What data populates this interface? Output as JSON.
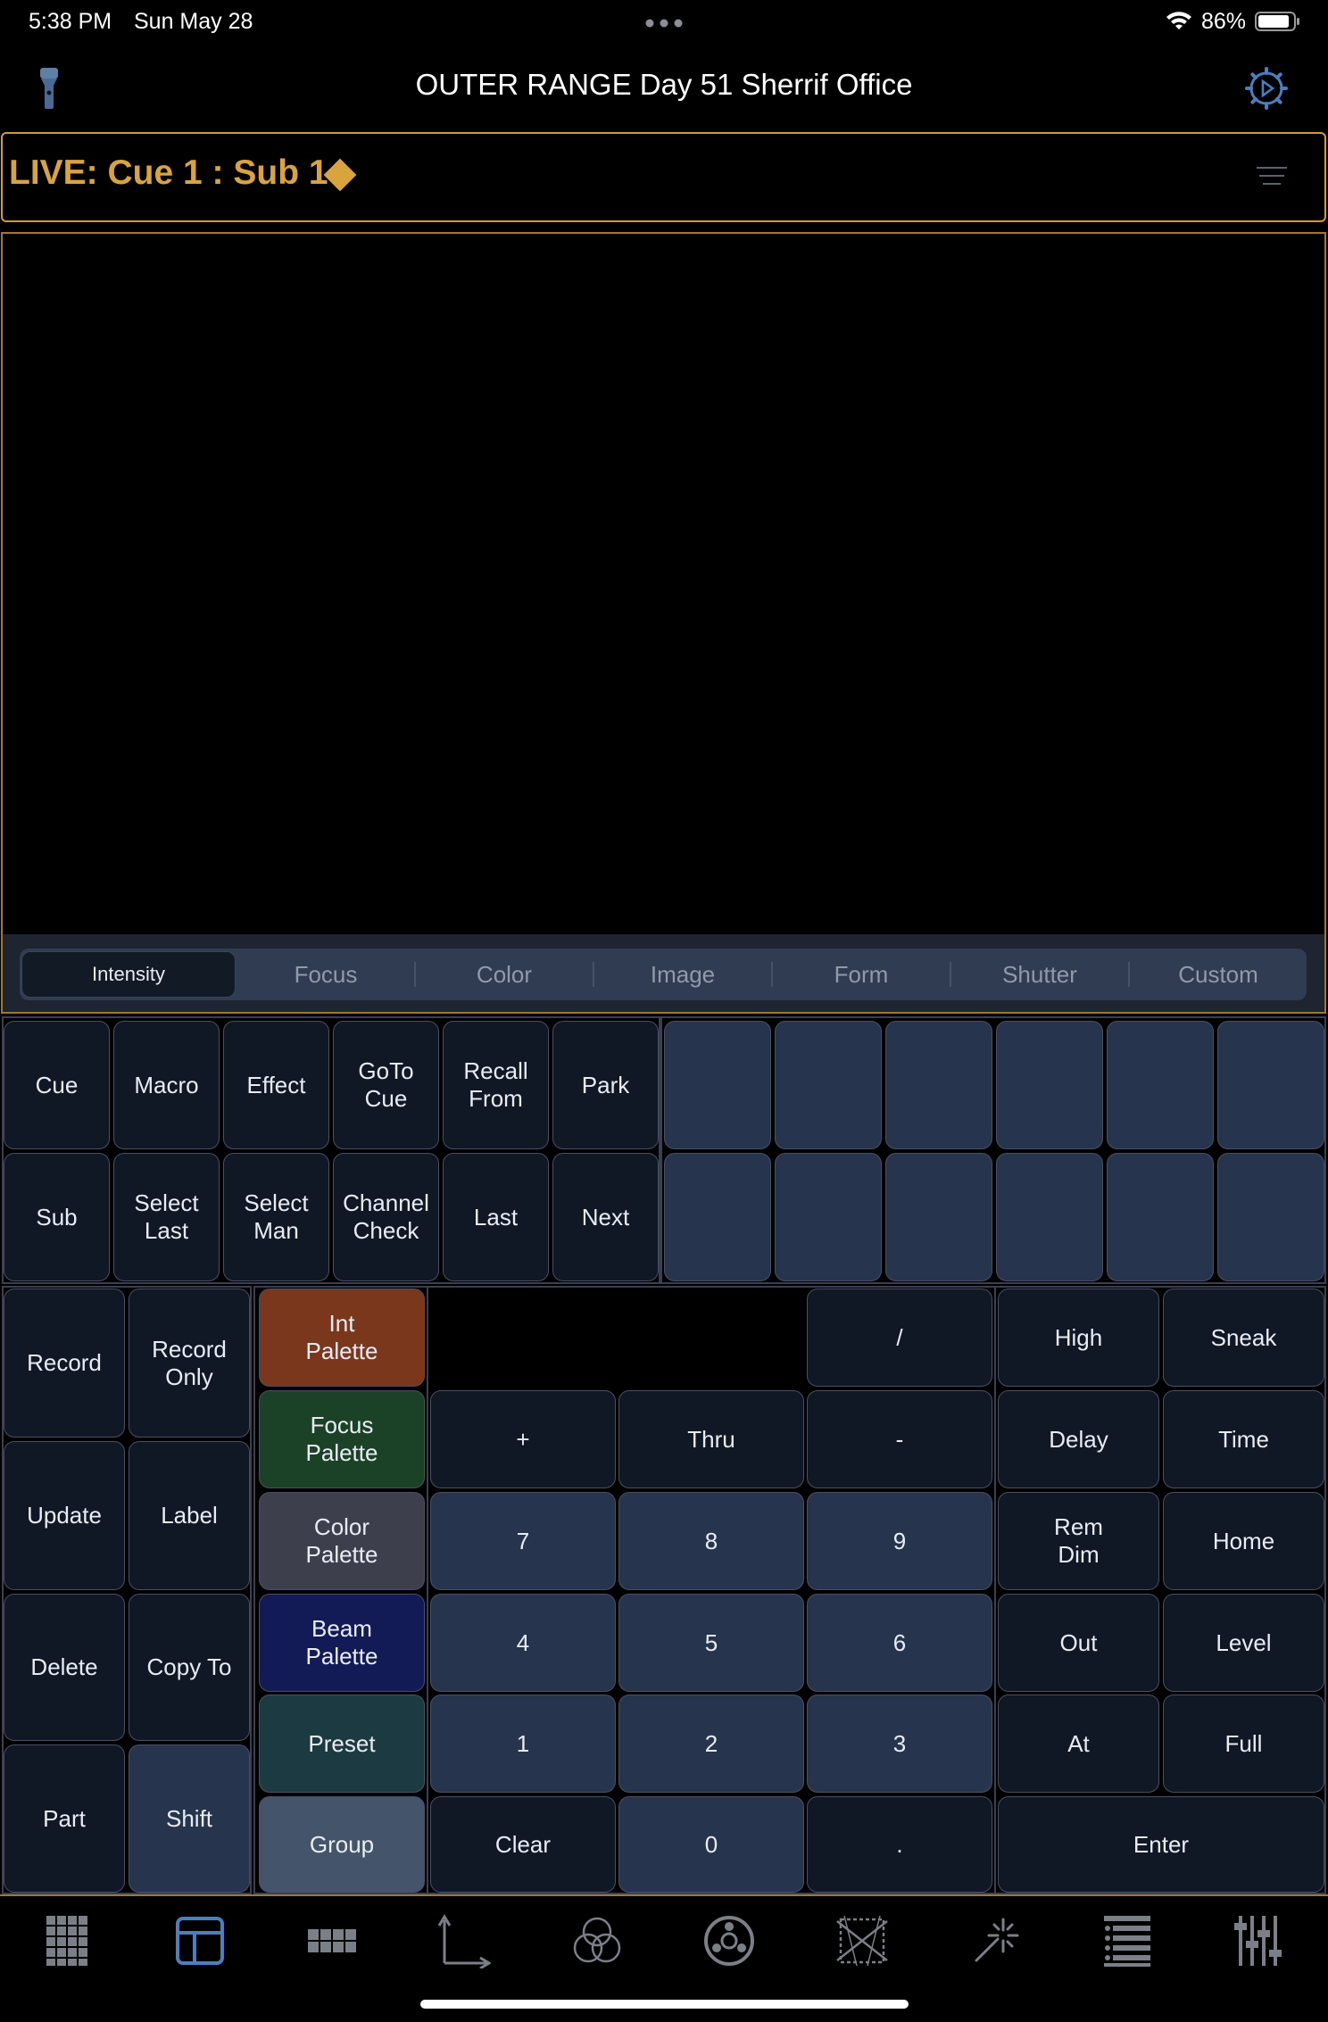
{
  "status_bar": {
    "time": "5:38 PM",
    "date": "Sun May 28",
    "battery": "86%"
  },
  "header": {
    "title": "OUTER RANGE  Day 51 Sherrif Office"
  },
  "live": {
    "text": "LIVE: Cue  1 : Sub 1"
  },
  "tabs": [
    "Intensity",
    "Focus",
    "Color",
    "Image",
    "Form",
    "Shutter",
    "Custom"
  ],
  "top_keys_row1": [
    "Cue",
    "Macro",
    "Effect",
    "GoTo\nCue",
    "Recall\nFrom",
    "Park"
  ],
  "top_keys_row2": [
    "Sub",
    "Select\nLast",
    "Select\nMan",
    "Channel\nCheck",
    "Last",
    "Next"
  ],
  "left_keys": [
    "Record",
    "Record\nOnly",
    "Update",
    "Label",
    "Delete",
    "Copy To",
    "Part",
    "Shift"
  ],
  "palette_keys": [
    "Int\nPalette",
    "Focus\nPalette",
    "Color\nPalette",
    "Beam\nPalette",
    "Preset",
    "Group"
  ],
  "numpad": {
    "slash": "/",
    "row_ops": [
      "+",
      "Thru",
      "-"
    ],
    "row_789": [
      "7",
      "8",
      "9"
    ],
    "row_456": [
      "4",
      "5",
      "6"
    ],
    "row_123": [
      "1",
      "2",
      "3"
    ],
    "row_0": [
      "Clear",
      "0",
      "."
    ]
  },
  "right_keys": [
    "High",
    "Sneak",
    "Delay",
    "Time",
    "Rem\nDim",
    "Home",
    "Out",
    "Level",
    "At",
    "Full"
  ],
  "enter_key": "Enter",
  "colors": {
    "accent": "#d9a33f",
    "nav_active": "#4a7fc1"
  }
}
